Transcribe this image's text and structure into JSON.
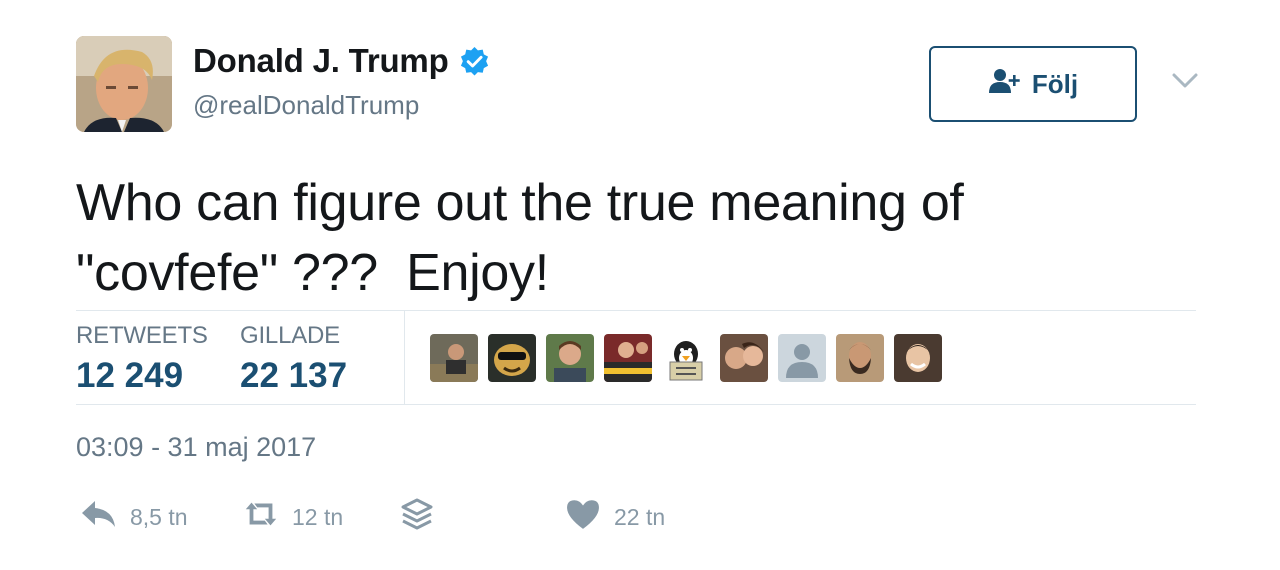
{
  "user": {
    "name": "Donald J. Trump",
    "handle": "@realDonaldTrump"
  },
  "follow_button": {
    "label": "Följ"
  },
  "tweet": {
    "text": "Who can figure out the true meaning of\n\"covfefe\" ???  Enjoy!"
  },
  "stats": {
    "retweets_label": "RETWEETS",
    "retweets_value": "12 249",
    "likes_label": "GILLADE",
    "likes_value": "22 137"
  },
  "timestamp": "03:09 - 31 maj 2017",
  "actions": {
    "reply_count": "8,5 tn",
    "retweet_count": "12 tn",
    "like_count": "22 tn"
  },
  "likers_count": 9,
  "colors": {
    "accent": "#1b4f72",
    "verified": "#1da1f2",
    "muted": "#657786",
    "icon": "#8899a6",
    "divider": "#e1e8ed"
  },
  "icons": [
    "verified-badge-icon",
    "follow-user-icon",
    "chevron-down-icon",
    "reply-icon",
    "retweet-icon",
    "direct-message-icon",
    "heart-icon"
  ]
}
